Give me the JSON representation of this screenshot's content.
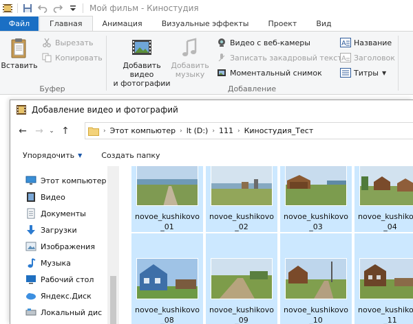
{
  "window": {
    "title": "Мой фильм - Киностудия"
  },
  "ribbon_tabs": [
    {
      "label": "Файл"
    },
    {
      "label": "Главная"
    },
    {
      "label": "Анимация"
    },
    {
      "label": "Визуальные эффекты"
    },
    {
      "label": "Проект"
    },
    {
      "label": "Вид"
    }
  ],
  "clipboard": {
    "paste": "Вставить",
    "cut": "Вырезать",
    "copy": "Копировать",
    "group": "Буфер"
  },
  "add": {
    "add_video_line1": "Добавить видео",
    "add_video_line2": "и фотографии",
    "add_music_line1": "Добавить",
    "add_music_line2": "музыку",
    "webcam": "Видео с веб-камеры",
    "narration": "Записать закадровый текст",
    "snapshot": "Моментальный снимок",
    "title": "Название",
    "caption": "Заголовок",
    "credits": "Титры",
    "group": "Добавление"
  },
  "dialog": {
    "title": "Добавление видео и фотографий",
    "breadcrumbs": [
      "Этот компьютер",
      "lt (D:)",
      "111",
      "Киностудия_Тест"
    ],
    "organize": "Упорядочить",
    "new_folder": "Создать папку"
  },
  "nav": [
    {
      "label": "Этот компьютер",
      "icon": "computer-icon"
    },
    {
      "label": "Видео",
      "icon": "video-folder-icon"
    },
    {
      "label": "Документы",
      "icon": "documents-icon"
    },
    {
      "label": "Загрузки",
      "icon": "downloads-icon"
    },
    {
      "label": "Изображения",
      "icon": "pictures-icon"
    },
    {
      "label": "Музыка",
      "icon": "music-icon"
    },
    {
      "label": "Рабочий стол",
      "icon": "desktop-icon"
    },
    {
      "label": "Яндекс.Диск",
      "icon": "yandex-disk-icon"
    },
    {
      "label": "Локальный дис",
      "icon": "local-disk-icon"
    }
  ],
  "files": [
    {
      "line1": "novoe_kushikovo",
      "line2": "_01"
    },
    {
      "line1": "novoe_kushikovo",
      "line2": "_02"
    },
    {
      "line1": "novoe_kushikovo",
      "line2": "_03"
    },
    {
      "line1": "novoe_kushikovo",
      "line2": "_04"
    },
    {
      "line1": "novoe_kushikovo",
      "line2": "_08"
    },
    {
      "line1": "novoe_kushikovo",
      "line2": "_09"
    },
    {
      "line1": "novoe_kushikovo",
      "line2": "_10"
    },
    {
      "line1": "novoe_kushikovo",
      "line2": "_11"
    }
  ],
  "colors": {
    "file_tab": "#1a6fc4",
    "selection": "#cce8ff",
    "accent": "#1a56a8"
  }
}
